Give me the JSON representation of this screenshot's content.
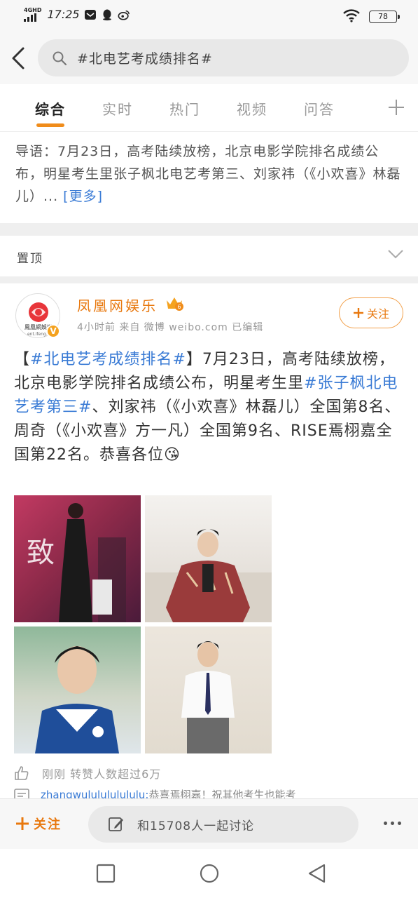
{
  "status_bar": {
    "network": "4GHD",
    "time": "17:25",
    "battery": "78",
    "icons": [
      "mail-icon",
      "qq-icon",
      "weibo-icon",
      "wifi-icon"
    ]
  },
  "search": {
    "query": "#北电艺考成绩排名#"
  },
  "tabs": [
    {
      "label": "综合",
      "active": true
    },
    {
      "label": "实时",
      "active": false
    },
    {
      "label": "热门",
      "active": false
    },
    {
      "label": "视频",
      "active": false
    },
    {
      "label": "问答",
      "active": false
    }
  ],
  "lead": {
    "text": "导语：7月23日，高考陆续放榜，北京电影学院排名成绩公布，明星考生里张子枫北电艺考第三、刘家祎（《小欢喜》林磊儿）...",
    "more": "[更多]"
  },
  "pinned": {
    "label": "置顶"
  },
  "post": {
    "author": "凤凰网娱乐",
    "avatar_text": "鳳凰網娛樂",
    "avatar_sub": "ent.ifeng.c",
    "meta": "4小时前  来自 微博 weibo.com  已编辑",
    "follow": "关注",
    "body_parts": {
      "p1": "【",
      "topic1": "#北电艺考成绩排名#",
      "p2": "】7月23日，高考陆续放榜，北京电影学院排名成绩公布，明星考生里",
      "topic2": "#张子枫北电艺考第三#",
      "p3": "、刘家祎（《小欢喜》林磊儿）全国第8名、周奇（《小欢喜》方一凡）全国第9名、RISE焉栩嘉全国第22名。恭喜各位😘"
    },
    "photo_caption": "致",
    "likes_text": "刚刚 转赞人数超过6万",
    "comment_user": "zhangwululululululu:",
    "comment_text": "恭喜焉栩嘉！祝其他考生也能考"
  },
  "action_bar": {
    "follow": "关注",
    "discuss": "和15708人一起讨论"
  },
  "colors": {
    "accent": "#e8780e",
    "link": "#3a7bd5",
    "underline": "#f08c1a"
  }
}
